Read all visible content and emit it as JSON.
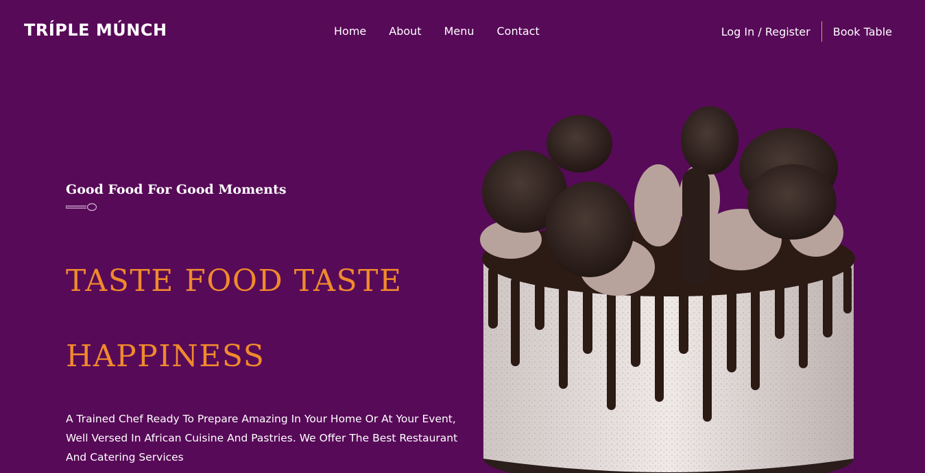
{
  "brand": {
    "logo_text": "TRÍPLE MÚNCH"
  },
  "nav": {
    "items": [
      {
        "label": "Home"
      },
      {
        "label": "About"
      },
      {
        "label": "Menu"
      },
      {
        "label": "Contact"
      }
    ]
  },
  "auth": {
    "login_label": "Log In / Register",
    "book_label": "Book Table"
  },
  "hero": {
    "tagline": "Good Food For Good Moments",
    "headline_line1": "TASTE FOOD TASTE",
    "headline_line2": "HAPPINESS",
    "description": "A Trained Chef Ready To Prepare Amazing In Your Home Or At Your Event, Well Versed In African Cuisine And Pastries. We Offer The Best Restaurant And Catering Services"
  },
  "colors": {
    "background": "#570a58",
    "accent": "#f08a2c",
    "divider": "#e8a23a"
  },
  "icons": {
    "spoon": "spoon-icon"
  }
}
